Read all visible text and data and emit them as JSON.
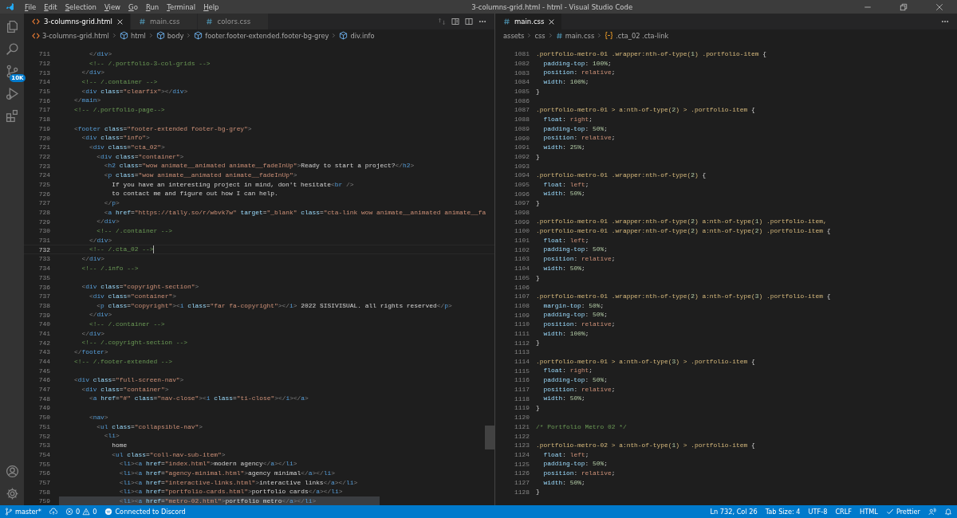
{
  "title_bar": {
    "menus": [
      "File",
      "Edit",
      "Selection",
      "View",
      "Go",
      "Run",
      "Terminal",
      "Help"
    ],
    "title": "3-columns-grid.html - html - Visual Studio Code"
  },
  "activity_bar": {
    "source_control_badge": "10K"
  },
  "editor_groups": [
    {
      "kind": "html",
      "tabs": [
        {
          "label": "3-columns-grid.html",
          "kind": "html",
          "selected": true
        },
        {
          "label": "main.css",
          "kind": "css",
          "selected": false
        },
        {
          "label": "colors.css",
          "kind": "css",
          "selected": false
        }
      ],
      "breadcrumbs": [
        {
          "label": "3-columns-grid.html",
          "kind": "html"
        },
        {
          "label": "html",
          "kind": "element"
        },
        {
          "label": "body",
          "kind": "element"
        },
        {
          "label": "footer.footer-extended.footer-bg-grey",
          "kind": "element"
        },
        {
          "label": "div.info",
          "kind": "element"
        }
      ],
      "lines": [
        {
          "n": "711",
          "text": "        </div>",
          "current": false,
          "selected": false
        },
        {
          "n": "712",
          "text": "        <!-- /.portfolio-3-col-grids -->",
          "current": false,
          "selected": false
        },
        {
          "n": "713",
          "text": "      </div>",
          "current": false,
          "selected": false
        },
        {
          "n": "714",
          "text": "      <!-- /.container -->",
          "current": false,
          "selected": false
        },
        {
          "n": "715",
          "text": "      <div class=\"clearfix\"></div>",
          "current": false,
          "selected": false
        },
        {
          "n": "716",
          "text": "    </main>",
          "current": false,
          "selected": false
        },
        {
          "n": "717",
          "text": "    <!-- /.portfolio-page-->",
          "current": false,
          "selected": false
        },
        {
          "n": "718",
          "current": false,
          "selected": false
        },
        {
          "n": "719",
          "text": "    <footer class=\"footer-extended footer-bg-grey\">",
          "current": false,
          "selected": false
        },
        {
          "n": "720",
          "text": "      <div class=\"info\">",
          "current": false,
          "selected": false
        },
        {
          "n": "721",
          "text": "        <div class=\"cta_02\">",
          "current": false,
          "selected": false
        },
        {
          "n": "722",
          "text": "          <div class=\"container\">",
          "current": false,
          "selected": false
        },
        {
          "n": "723",
          "text": "            <h2 class=\"wow animate__animated animate__fadeInUp\">Ready to start a project?</h2>",
          "current": false,
          "selected": false
        },
        {
          "n": "724",
          "text": "            <p class=\"wow animate__animated animate__fadeInUp\">",
          "current": false,
          "selected": false
        },
        {
          "n": "725",
          "text": "              If you have an interesting project in mind, don't hesitate<br />",
          "current": false,
          "selected": false
        },
        {
          "n": "726",
          "text": "              to contact me and figure out how I can help.",
          "current": false,
          "selected": false
        },
        {
          "n": "727",
          "text": "            </p>",
          "current": false,
          "selected": false
        },
        {
          "n": "728",
          "text": "            <a href=\"https://tally.so/r/wbvk7w\" target=\"_blank\" class=\"cta-link wow animate__animated animate__fa",
          "current": false,
          "selected": false
        },
        {
          "n": "729",
          "text": "          </div>",
          "current": false,
          "selected": false
        },
        {
          "n": "730",
          "text": "          <!-- /.container -->",
          "current": false,
          "selected": false
        },
        {
          "n": "731",
          "text": "        </div>",
          "current": false,
          "selected": false
        },
        {
          "n": "732",
          "text": "        <!-- /.cta_02 -->",
          "current": true,
          "selected": false
        },
        {
          "n": "733",
          "text": "      </div>",
          "current": false,
          "selected": false
        },
        {
          "n": "734",
          "text": "      <!-- /.info -->",
          "current": false,
          "selected": false
        },
        {
          "n": "735",
          "current": false,
          "selected": false
        },
        {
          "n": "736",
          "text": "      <div class=\"copyright-section\">",
          "current": false,
          "selected": false
        },
        {
          "n": "737",
          "text": "        <div class=\"container\">",
          "current": false,
          "selected": false
        },
        {
          "n": "738",
          "text": "          <p class=\"copyright\"><i class=\"far fa-copyright\"></i> 2022 SISIVISUAL. all rights reserved</p>",
          "current": false,
          "selected": false
        },
        {
          "n": "739",
          "text": "        </div>",
          "current": false,
          "selected": false
        },
        {
          "n": "740",
          "text": "        <!-- /.container -->",
          "current": false,
          "selected": false
        },
        {
          "n": "741",
          "text": "      </div>",
          "current": false,
          "selected": false
        },
        {
          "n": "742",
          "text": "      <!-- /.copyright-section -->",
          "current": false,
          "selected": false
        },
        {
          "n": "743",
          "text": "    </footer>",
          "current": false,
          "selected": false
        },
        {
          "n": "744",
          "text": "    <!-- /.footer-extended -->",
          "current": false,
          "selected": false
        },
        {
          "n": "745",
          "current": false,
          "selected": false
        },
        {
          "n": "746",
          "text": "    <div class=\"full-screen-nav\">",
          "current": false,
          "selected": false
        },
        {
          "n": "747",
          "text": "      <div class=\"container\">",
          "current": false,
          "selected": false
        },
        {
          "n": "748",
          "text": "        <a href=\"#\" class=\"nav-close\"><i class=\"ti-close\"></i></a>",
          "current": false,
          "selected": false
        },
        {
          "n": "749",
          "current": false,
          "selected": false
        },
        {
          "n": "750",
          "text": "        <nav>",
          "current": false,
          "selected": false
        },
        {
          "n": "751",
          "text": "          <ul class=\"collapsible-nav\">",
          "current": false,
          "selected": false
        },
        {
          "n": "752",
          "text": "            <li>",
          "current": false,
          "selected": false
        },
        {
          "n": "753",
          "text": "              home",
          "current": false,
          "selected": false
        },
        {
          "n": "754",
          "text": "              <ul class=\"coll-nav-sub-item\">",
          "current": false,
          "selected": false
        },
        {
          "n": "755",
          "text": "                <li><a href=\"index.html\">modern agency</a></li>",
          "current": false,
          "selected": false
        },
        {
          "n": "756",
          "text": "                <li><a href=\"agency-minimal.html\">agency minimal</a></li>",
          "current": false,
          "selected": false
        },
        {
          "n": "757",
          "text": "                <li><a href=\"interactive-links.html\">interactive links</a></li>",
          "current": false,
          "selected": false
        },
        {
          "n": "758",
          "text": "                <li><a href=\"portfolio-cards.html\">portfolio cards</a></li>",
          "current": false,
          "selected": false
        },
        {
          "n": "759",
          "text": "                <li><a href=\"metro-02.html\">portfolio metro</a></li>",
          "current": false,
          "selected": true
        }
      ]
    },
    {
      "kind": "css",
      "tabs": [
        {
          "label": "main.css",
          "kind": "css",
          "selected": true
        }
      ],
      "breadcrumbs": [
        {
          "label": "assets",
          "kind": "folder"
        },
        {
          "label": "css",
          "kind": "folder"
        },
        {
          "label": "main.css",
          "kind": "css"
        },
        {
          "label": ".cta_02 .cta-link",
          "kind": "selector"
        }
      ],
      "lines": [
        {
          "n": "1081",
          "text": ".portfolio-metro-01 .wrapper:nth-of-type(1) .portfolio-item {"
        },
        {
          "n": "1082",
          "text": "  padding-top: 100%;"
        },
        {
          "n": "1083",
          "text": "  position: relative;"
        },
        {
          "n": "1084",
          "text": "  width: 100%;"
        },
        {
          "n": "1085",
          "text": "}"
        },
        {
          "n": "1086"
        },
        {
          "n": "1087",
          "text": ".portfolio-metro-01 > a:nth-of-type(2) > .portfolio-item {"
        },
        {
          "n": "1088",
          "text": "  float: right;"
        },
        {
          "n": "1089",
          "text": "  padding-top: 50%;"
        },
        {
          "n": "1090",
          "text": "  position: relative;"
        },
        {
          "n": "1091",
          "text": "  width: 25%;"
        },
        {
          "n": "1092",
          "text": "}"
        },
        {
          "n": "1093"
        },
        {
          "n": "1094",
          "text": ".portfolio-metro-01 .wrapper:nth-of-type(2) {"
        },
        {
          "n": "1095",
          "text": "  float: left;"
        },
        {
          "n": "1096",
          "text": "  width: 50%;"
        },
        {
          "n": "1097",
          "text": "}"
        },
        {
          "n": "1098"
        },
        {
          "n": "1099",
          "text": ".portfolio-metro-01 .wrapper:nth-of-type(2) a:nth-of-type(1) .portfolio-item,"
        },
        {
          "n": "1100",
          "text": ".portfolio-metro-01 .wrapper:nth-of-type(2) a:nth-of-type(2) .portfolio-item {"
        },
        {
          "n": "1101",
          "text": "  float: left;"
        },
        {
          "n": "1102",
          "text": "  padding-top: 50%;"
        },
        {
          "n": "1103",
          "text": "  position: relative;"
        },
        {
          "n": "1104",
          "text": "  width: 50%;"
        },
        {
          "n": "1105",
          "text": "}"
        },
        {
          "n": "1106"
        },
        {
          "n": "1107",
          "text": ".portfolio-metro-01 .wrapper:nth-of-type(2) a:nth-of-type(3) .portfolio-item {"
        },
        {
          "n": "1108",
          "text": "  margin-top: 50%;"
        },
        {
          "n": "1109",
          "text": "  padding-top: 50%;"
        },
        {
          "n": "1110",
          "text": "  position: relative;"
        },
        {
          "n": "1111",
          "text": "  width: 100%;"
        },
        {
          "n": "1112",
          "text": "}"
        },
        {
          "n": "1113"
        },
        {
          "n": "1114",
          "text": ".portfolio-metro-01 > a:nth-of-type(3) > .portfolio-item {"
        },
        {
          "n": "1115",
          "text": "  float: right;"
        },
        {
          "n": "1116",
          "text": "  padding-top: 50%;"
        },
        {
          "n": "1117",
          "text": "  position: relative;"
        },
        {
          "n": "1118",
          "text": "  width: 50%;"
        },
        {
          "n": "1119",
          "text": "}"
        },
        {
          "n": "1120"
        },
        {
          "n": "1121",
          "text": "/* Portfolio Metro 02 */"
        },
        {
          "n": "1122"
        },
        {
          "n": "1123",
          "text": ".portfolio-metro-02 > a:nth-of-type(1) > .portfolio-item {"
        },
        {
          "n": "1124",
          "text": "  float: left;"
        },
        {
          "n": "1125",
          "text": "  padding-top: 50%;"
        },
        {
          "n": "1126",
          "text": "  position: relative;"
        },
        {
          "n": "1127",
          "text": "  width: 50%;"
        },
        {
          "n": "1128",
          "text": "}"
        }
      ]
    }
  ],
  "status_bar": {
    "branch": "master*",
    "errors": "0",
    "warnings": "0",
    "discord": "Connected to Discord",
    "position": "Ln 732, Col 26",
    "tab_size": "Tab Size: 4",
    "encoding": "UTF-8",
    "eol": "CRLF",
    "language": "HTML",
    "formatter": "Prettier"
  }
}
